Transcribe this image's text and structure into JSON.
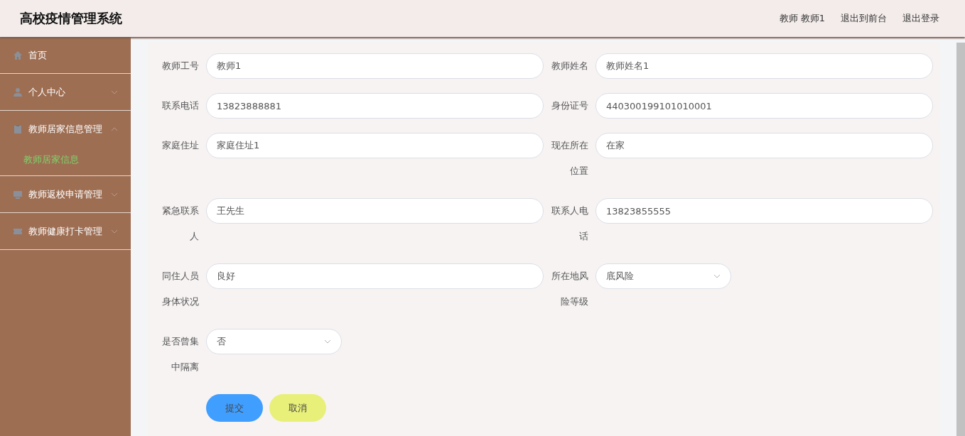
{
  "header": {
    "title": "高校疫情管理系统",
    "user": "教师 教师1",
    "links": [
      "退出到前台",
      "退出登录"
    ]
  },
  "sidebar": {
    "items": [
      {
        "label": "首页",
        "kind": "link"
      },
      {
        "label": "个人中心",
        "kind": "menu",
        "expanded": false
      },
      {
        "label": "教师居家信息管理",
        "kind": "menu",
        "expanded": true,
        "children": [
          {
            "label": "教师居家信息",
            "selected": true
          }
        ]
      },
      {
        "label": "教师返校申请管理",
        "kind": "menu",
        "expanded": false
      },
      {
        "label": "教师健康打卡管理",
        "kind": "menu",
        "expanded": false
      }
    ]
  },
  "form": {
    "fields": [
      {
        "label": "教师工号",
        "kind": "input",
        "value": "教师1"
      },
      {
        "label": "教师姓名",
        "kind": "input",
        "value": "教师姓名1"
      },
      {
        "label": "联系电话",
        "kind": "input",
        "value": "13823888881"
      },
      {
        "label": "身份证号",
        "kind": "input",
        "value": "440300199101010001"
      },
      {
        "label": "家庭住址",
        "kind": "input",
        "value": "家庭住址1"
      },
      {
        "label": "现在所在位置",
        "kind": "input",
        "value": "在家"
      },
      {
        "label": "紧急联系人",
        "kind": "input",
        "value": "王先生"
      },
      {
        "label": "联系人电话",
        "kind": "input",
        "value": "13823855555"
      },
      {
        "label": "同住人员身体状况",
        "kind": "input",
        "value": "良好"
      },
      {
        "label": "所在地风险等级",
        "kind": "select",
        "value": "底风险"
      },
      {
        "label": "是否曾集中隔离",
        "kind": "select",
        "value": "否"
      }
    ],
    "buttons": [
      {
        "label": "提交",
        "kind": "primary"
      },
      {
        "label": "取消",
        "kind": "secondary"
      }
    ]
  }
}
